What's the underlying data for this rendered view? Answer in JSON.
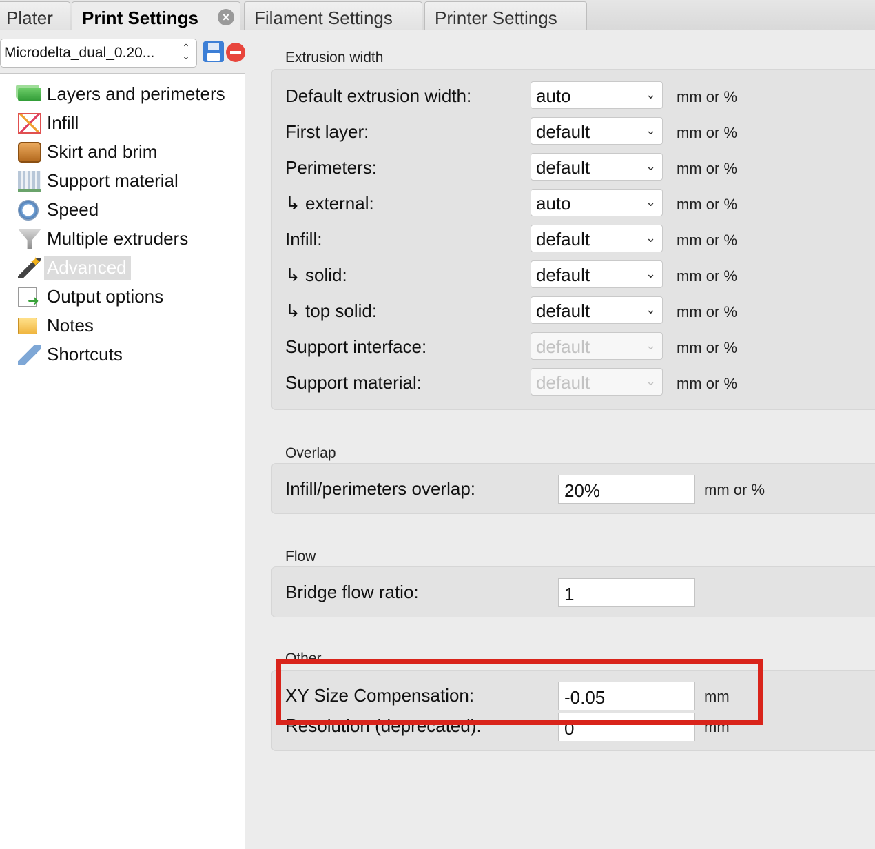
{
  "tabs": [
    {
      "label": "Plater"
    },
    {
      "label": "Print Settings"
    },
    {
      "label": "Filament Settings"
    },
    {
      "label": "Printer Settings"
    }
  ],
  "preset": {
    "selected": "Microdelta_dual_0.20..."
  },
  "sidebar": {
    "items": [
      {
        "label": "Layers and perimeters",
        "icon": "layers-icon"
      },
      {
        "label": "Infill",
        "icon": "infill-icon"
      },
      {
        "label": "Skirt and brim",
        "icon": "skirt-icon"
      },
      {
        "label": "Support material",
        "icon": "support-icon"
      },
      {
        "label": "Speed",
        "icon": "speed-icon"
      },
      {
        "label": "Multiple extruders",
        "icon": "funnel-icon"
      },
      {
        "label": "Advanced",
        "icon": "magic-wand-icon",
        "selected": true
      },
      {
        "label": "Output options",
        "icon": "output-icon"
      },
      {
        "label": "Notes",
        "icon": "notes-icon"
      },
      {
        "label": "Shortcuts",
        "icon": "wrench-icon"
      }
    ]
  },
  "extrusion_width": {
    "title": "Extrusion width",
    "rows": [
      {
        "label": "Default extrusion width:",
        "value": "auto",
        "unit": "mm or %"
      },
      {
        "label": "First layer:",
        "value": "default",
        "unit": "mm or %"
      },
      {
        "label": "Perimeters:",
        "value": "default",
        "unit": "mm or %"
      },
      {
        "label": "↳ external:",
        "value": "auto",
        "unit": "mm or %"
      },
      {
        "label": "Infill:",
        "value": "default",
        "unit": "mm or %"
      },
      {
        "label": "↳ solid:",
        "value": "default",
        "unit": "mm or %"
      },
      {
        "label": "↳ top solid:",
        "value": "default",
        "unit": "mm or %"
      },
      {
        "label": "Support interface:",
        "value": "default",
        "unit": "mm or %",
        "disabled": true
      },
      {
        "label": "Support material:",
        "value": "default",
        "unit": "mm or %",
        "disabled": true
      }
    ]
  },
  "overlap": {
    "title": "Overlap",
    "label": "Infill/perimeters overlap:",
    "value": "20%",
    "unit": "mm or %"
  },
  "flow": {
    "title": "Flow",
    "label": "Bridge flow ratio:",
    "value": "1"
  },
  "other": {
    "title": "Other",
    "xy_label": "XY Size Compensation:",
    "xy_value": "-0.05",
    "xy_unit": "mm",
    "res_label": "Resolution (deprecated):",
    "res_value": "0",
    "res_unit": "mm"
  },
  "colors": {
    "highlight": "#d9241b",
    "selected_bg": "#dcdcdc"
  }
}
